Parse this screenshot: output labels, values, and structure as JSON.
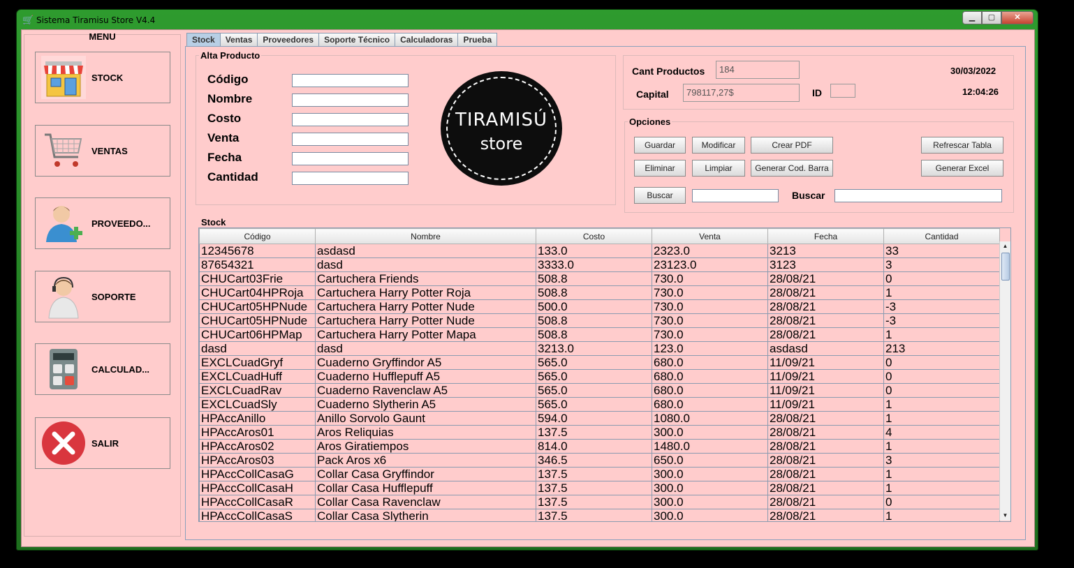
{
  "window": {
    "title": "Sistema Tiramisu Store V4.4"
  },
  "menu": {
    "title": "MENU",
    "items": [
      {
        "label": "STOCK",
        "icon": "store-icon"
      },
      {
        "label": "VENTAS",
        "icon": "shopping-cart-icon"
      },
      {
        "label": "PROVEEDO...",
        "icon": "add-user-icon"
      },
      {
        "label": "SOPORTE",
        "icon": "support-agent-icon"
      },
      {
        "label": "CALCULAD...",
        "icon": "calculator-icon"
      },
      {
        "label": "SALIR",
        "icon": "exit-x-icon"
      }
    ]
  },
  "tabs": [
    "Stock",
    "Ventas",
    "Proveedores",
    "Soporte Técnico",
    "Calculadoras",
    "Prueba"
  ],
  "alta": {
    "title": "Alta Producto",
    "fields": [
      "Código",
      "Nombre",
      "Costo",
      "Venta",
      "Fecha",
      "Cantidad"
    ]
  },
  "logo": {
    "line1": "TIRAMISÚ",
    "line2": "store"
  },
  "info": {
    "cant_label": "Cant Productos",
    "cant_value": "184",
    "capital_label": "Capital",
    "capital_value": "798117,27$",
    "id_label": "ID",
    "date": "30/03/2022",
    "time": "12:04:26"
  },
  "opciones": {
    "title": "Opciones",
    "guardar": "Guardar",
    "modificar": "Modificar",
    "crear_pdf": "Crear PDF",
    "refrescar": "Refrescar Tabla",
    "eliminar": "Eliminar",
    "limpiar": "Limpiar",
    "cod_barra": "Generar Cod. Barra",
    "excel": "Generar Excel",
    "buscar_btn": "Buscar",
    "buscar_label": "Buscar"
  },
  "stock": {
    "title": "Stock",
    "columns": [
      "Código",
      "Nombre",
      "Costo",
      "Venta",
      "Fecha",
      "Cantidad"
    ],
    "rows": [
      [
        "12345678",
        "asdasd",
        "133.0",
        "2323.0",
        "3213",
        "33"
      ],
      [
        "87654321",
        "dasd",
        "3333.0",
        "23123.0",
        "3123",
        "3"
      ],
      [
        "CHUCart03Frie",
        "Cartuchera Friends",
        "508.8",
        "730.0",
        "28/08/21",
        "0"
      ],
      [
        "CHUCart04HPRoja",
        "Cartuchera Harry Potter Roja",
        "508.8",
        "730.0",
        "28/08/21",
        "1"
      ],
      [
        "CHUCart05HPNude",
        "Cartuchera Harry Potter Nude",
        "500.0",
        "730.0",
        "28/08/21",
        "-3"
      ],
      [
        "CHUCart05HPNude",
        "Cartuchera Harry Potter Nude",
        "508.8",
        "730.0",
        "28/08/21",
        "-3"
      ],
      [
        "CHUCart06HPMap",
        "Cartuchera Harry Potter Mapa",
        "508.8",
        "730.0",
        "28/08/21",
        "1"
      ],
      [
        "dasd",
        "dasd",
        "3213.0",
        "123.0",
        "asdasd",
        "213"
      ],
      [
        "EXCLCuadGryf",
        "Cuaderno Gryffindor A5",
        "565.0",
        "680.0",
        "11/09/21",
        "0"
      ],
      [
        "EXCLCuadHuff",
        "Cuaderno Hufflepuff A5",
        "565.0",
        "680.0",
        "11/09/21",
        "0"
      ],
      [
        "EXCLCuadRav",
        "Cuaderno Ravenclaw A5",
        "565.0",
        "680.0",
        "11/09/21",
        "0"
      ],
      [
        "EXCLCuadSly",
        "Cuaderno Slytherin A5",
        "565.0",
        "680.0",
        "11/09/21",
        "1"
      ],
      [
        "HPAccAnillo",
        "Anillo Sorvolo Gaunt",
        "594.0",
        "1080.0",
        "28/08/21",
        "1"
      ],
      [
        "HPAccAros01",
        "Aros Reliquias",
        "137.5",
        "300.0",
        "28/08/21",
        "4"
      ],
      [
        "HPAccAros02",
        "Aros Giratiempos",
        "814.0",
        "1480.0",
        "28/08/21",
        "1"
      ],
      [
        "HPAccAros03",
        "Pack Aros x6",
        "346.5",
        "650.0",
        "28/08/21",
        "3"
      ],
      [
        "HPAccCollCasaG",
        "Collar Casa Gryffindor",
        "137.5",
        "300.0",
        "28/08/21",
        "1"
      ],
      [
        "HPAccCollCasaH",
        "Collar Casa Hufflepuff",
        "137.5",
        "300.0",
        "28/08/21",
        "1"
      ],
      [
        "HPAccCollCasaR",
        "Collar Casa Ravenclaw",
        "137.5",
        "300.0",
        "28/08/21",
        "0"
      ],
      [
        "HPAccCollCasaS",
        "Collar Casa Slytherin",
        "137.5",
        "300.0",
        "28/08/21",
        "1"
      ]
    ]
  }
}
